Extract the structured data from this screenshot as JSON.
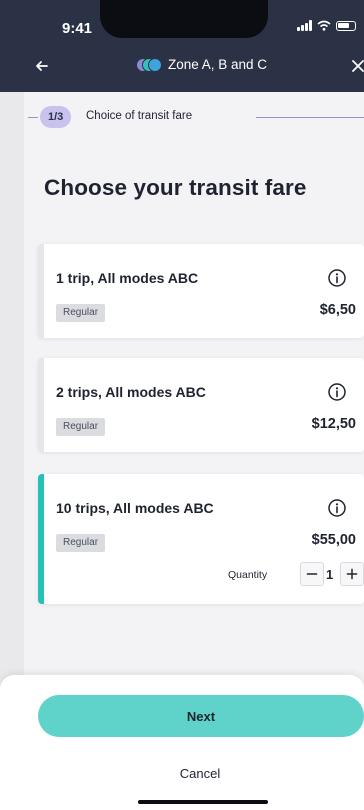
{
  "status_bar": {
    "time": "9:41"
  },
  "header": {
    "title": "Zone A, B and C",
    "back_icon": "arrow-left-icon",
    "close_icon": "close-icon",
    "zone_circle_colors": [
      "#8e87d6",
      "#2ec3b8",
      "#3fa3dd"
    ]
  },
  "step": {
    "badge": "1/3",
    "label": "Choice of transit fare"
  },
  "page_title": "Choose your transit fare",
  "fares": [
    {
      "name": "1 trip, All modes ABC",
      "category": "Regular",
      "price": "$6,50",
      "selected": false
    },
    {
      "name": "2 trips, All modes ABC",
      "category": "Regular",
      "price": "$12,50",
      "selected": false
    },
    {
      "name": "10 trips, All modes ABC",
      "category": "Regular",
      "price": "$55,00",
      "selected": true,
      "quantity_label": "Quantity",
      "quantity": "1"
    }
  ],
  "actions": {
    "next_label": "Next",
    "cancel_label": "Cancel"
  },
  "colors": {
    "header_bg": "#2b3245",
    "accent_teal": "#25c1b7",
    "next_button": "#5fd3c9",
    "step_badge": "#c9c2ee"
  }
}
